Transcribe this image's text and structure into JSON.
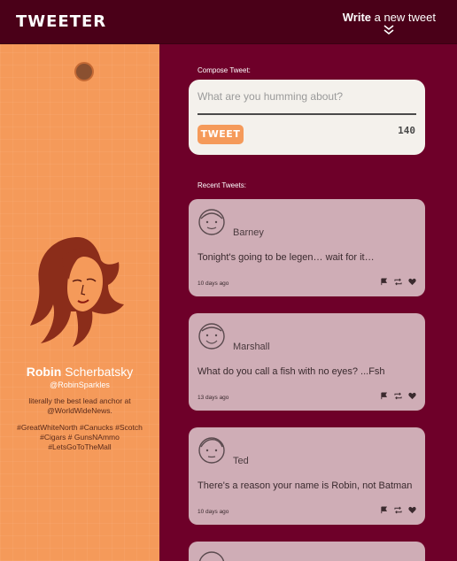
{
  "header": {
    "brand": "TWEETER",
    "write_bold": "Write",
    "write_rest": " a new tweet"
  },
  "profile": {
    "first_name": "Robin",
    "last_name": " Scherbatsky",
    "handle": "@RobinSparkles",
    "bio": "literally the best lead anchor at @WorldWideNews.",
    "tags": "#GreatWhiteNorth #Canucks #Scotch #Cigars # GunsNAmmo #LetsGoToTheMall"
  },
  "compose": {
    "label": "Compose Tweet:",
    "placeholder": "What are you humming about?",
    "button": "TWEET",
    "counter": "140"
  },
  "recent_label": "Recent Tweets:",
  "tweets": [
    {
      "name": "Barney",
      "text": "Tonight's going to be legen… wait for it…",
      "time": "10 days ago"
    },
    {
      "name": "Marshall",
      "text": "What do you call a fish with no eyes? ...Fsh",
      "time": "13 days ago"
    },
    {
      "name": "Ted",
      "text": "There's a reason your name is Robin, not Batman",
      "time": "10 days ago"
    }
  ],
  "colors": {
    "header": "#4a0018",
    "main_bg": "#6e0029",
    "sidebar": "#f59a5a",
    "tweet_card": "#cfadb6",
    "compose_card": "#f4f1ec"
  },
  "icons": [
    "flag-icon",
    "retweet-icon",
    "heart-icon",
    "chevron-down-icon",
    "avatar-icon"
  ]
}
